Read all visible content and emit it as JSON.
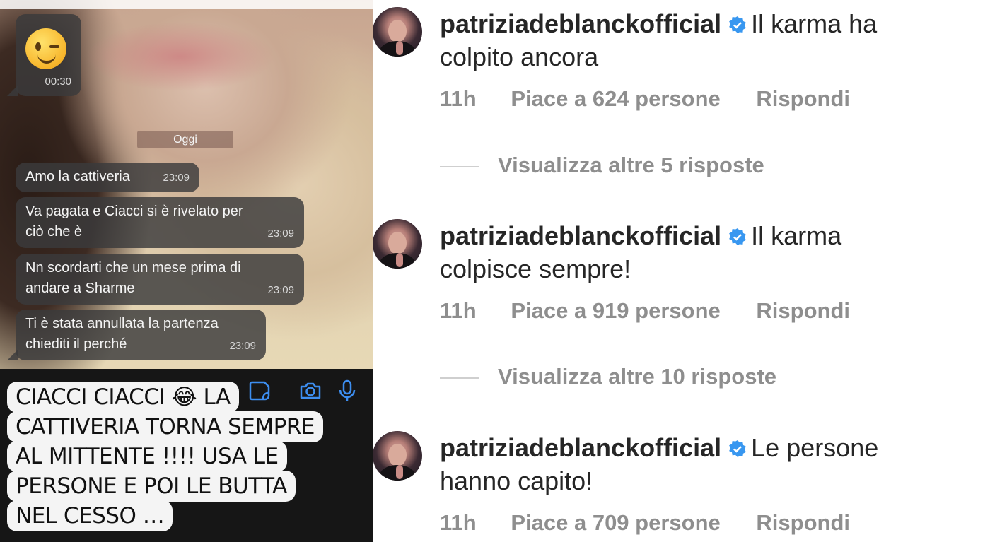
{
  "chat": {
    "emoji_message": {
      "time": "00:30"
    },
    "date_separator": "Oggi",
    "messages": [
      {
        "text": "Amo la cattiveria",
        "time": "23:09"
      },
      {
        "line1": "Va pagata e Ciacci si è rivelato per",
        "line2": "ciò che è",
        "time": "23:09"
      },
      {
        "line1": "Nn scordarti che un mese prima di",
        "line2": "andare a Sharme",
        "time": "23:09"
      },
      {
        "line1": "Ti è stata annullata la partenza",
        "line2": "chiediti il perché",
        "time": "23:09"
      }
    ],
    "caption_lines": [
      "CIACCI CIACCI 😂 LA",
      "CATTIVERIA TORNA SEMPRE",
      "AL MITTENTE !!!!  USA LE",
      "PERSONE E POI LE BUTTA",
      "NEL CESSO …"
    ],
    "input_icons": [
      "sticker-icon",
      "camera-icon",
      "microphone-icon"
    ]
  },
  "comments": [
    {
      "username": "patriziadeblanckofficial",
      "text_part1": "Il karma ha",
      "text_part2": "colpito ancora",
      "age": "11h",
      "likes": "Piace a 624 persone",
      "reply": "Rispondi",
      "view_more": "Visualizza altre 5 risposte"
    },
    {
      "username": "patriziadeblanckofficial",
      "text_part1": "Il karma",
      "text_part2": "colpisce sempre!",
      "age": "11h",
      "likes": "Piace a 919 persone",
      "reply": "Rispondi",
      "view_more": "Visualizza altre 10 risposte"
    },
    {
      "username": "patriziadeblanckofficial",
      "text_part1": "Le persone",
      "text_part2": "hanno capito!",
      "age": "11h",
      "likes": "Piace a 709 persone",
      "reply": "Rispondi"
    }
  ],
  "colors": {
    "verified": "#3897f0",
    "meta_text": "#8e8e8e",
    "bubble": "#3a3a3c"
  }
}
